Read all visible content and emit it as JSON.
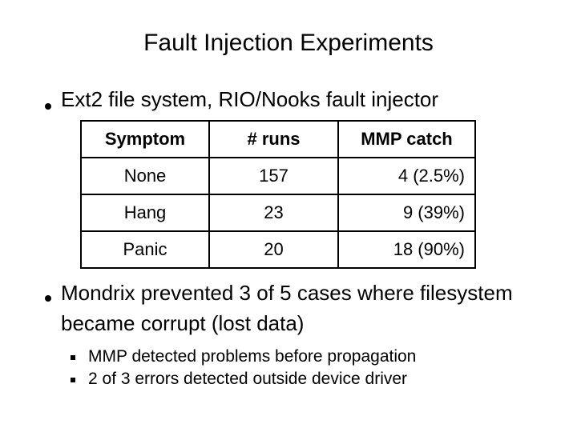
{
  "slide": {
    "title": "Fault Injection Experiments",
    "bullets": [
      {
        "marker": "round-bullet",
        "text": "Ext2 file system, RIO/Nooks fault injector"
      },
      {
        "marker": "round-bullet",
        "text": "Mondrix prevented 3 of 5 cases where filesystem became corrupt (lost data)"
      }
    ],
    "sub_bullets": [
      {
        "marker": "square-bullet",
        "text": "MMP detected problems before propagation"
      },
      {
        "marker": "square-bullet",
        "text": "2 of 3 errors detected outside device driver"
      }
    ],
    "table": {
      "headers": [
        "Symptom",
        "# runs",
        "MMP catch"
      ],
      "rows": [
        [
          "None",
          "157",
          "4 (2.5%)"
        ],
        [
          "Hang",
          "23",
          "9 (39%)"
        ],
        [
          "Panic",
          "20",
          "18 (90%)"
        ]
      ]
    },
    "colors": {
      "background": "#ffffff",
      "text": "#000000",
      "border": "#000000"
    }
  }
}
